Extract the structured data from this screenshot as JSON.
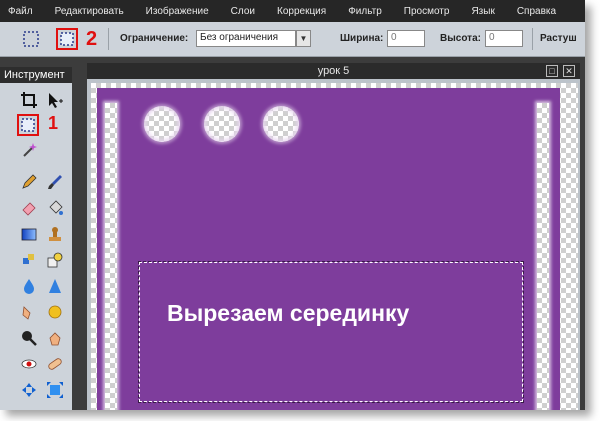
{
  "menu": {
    "items": [
      "Файл",
      "Редактировать",
      "Изображение",
      "Слои",
      "Коррекция",
      "Фильтр",
      "Просмотр",
      "Язык",
      "Справка"
    ]
  },
  "options": {
    "constraint_label": "Ограничение:",
    "constraint_value": "Без ограничения",
    "width_label": "Ширина:",
    "width_value": "0",
    "height_label": "Высота:",
    "height_value": "0",
    "more_label": "Растуш"
  },
  "tools": {
    "title": "Инструмент"
  },
  "document": {
    "title": "урок 5",
    "caption": "Вырезаем серединку"
  },
  "annotations": {
    "callout_1": "1",
    "callout_2": "2"
  },
  "colors": {
    "canvas_fill": "#7e3d9c",
    "highlight": "#e01010"
  }
}
